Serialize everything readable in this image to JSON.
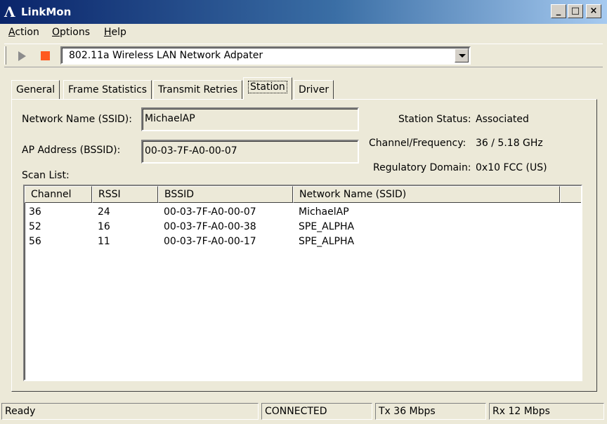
{
  "window": {
    "title": "LinkMon",
    "minimize_glyph": "_",
    "maximize_glyph": "□",
    "close_glyph": "×"
  },
  "menu": [
    {
      "label": "Action",
      "accel": "A",
      "rest": "ction"
    },
    {
      "label": "Options",
      "accel": "O",
      "rest": "ptions"
    },
    {
      "label": "Help",
      "accel": "H",
      "rest": "elp"
    }
  ],
  "toolbar": {
    "adapter": "802.11a Wireless LAN Network Adpater",
    "icons": {
      "play": "play-icon",
      "stop": "stop-icon"
    },
    "stop_color": "#ff5a1f"
  },
  "tabs": [
    "General",
    "Frame Statistics",
    "Transmit Retries",
    "Station",
    "Driver"
  ],
  "active_tab": "Station",
  "station": {
    "ssid_label": "Network Name (SSID):",
    "ssid_value": "MichaelAP",
    "bssid_label": "AP Address (BSSID):",
    "bssid_value": "00-03-7F-A0-00-07",
    "status_label": "Station Status:",
    "status_value": "Associated",
    "channel_label": "Channel/Frequency:",
    "channel_value": "36 / 5.18 GHz",
    "regdomain_label": "Regulatory Domain:",
    "regdomain_value": "0x10 FCC (US)",
    "scanlist_label": "Scan List:"
  },
  "scan_list": {
    "columns": [
      "Channel",
      "RSSI",
      "BSSID",
      "Network Name (SSID)"
    ],
    "rows": [
      [
        "36",
        "24",
        "00-03-7F-A0-00-07",
        "MichaelAP"
      ],
      [
        "52",
        "16",
        "00-03-7F-A0-00-38",
        "SPE_ALPHA"
      ],
      [
        "56",
        "11",
        "00-03-7F-A0-00-17",
        "SPE_ALPHA"
      ]
    ]
  },
  "statusbar": {
    "state": "Ready",
    "connection": "CONNECTED",
    "tx": "Tx 36 Mbps",
    "rx": "Rx 12 Mbps"
  },
  "colors": {
    "title_gradient_start": "#0a246a",
    "title_gradient_end": "#a6caf0",
    "face": "#ece9d8"
  }
}
